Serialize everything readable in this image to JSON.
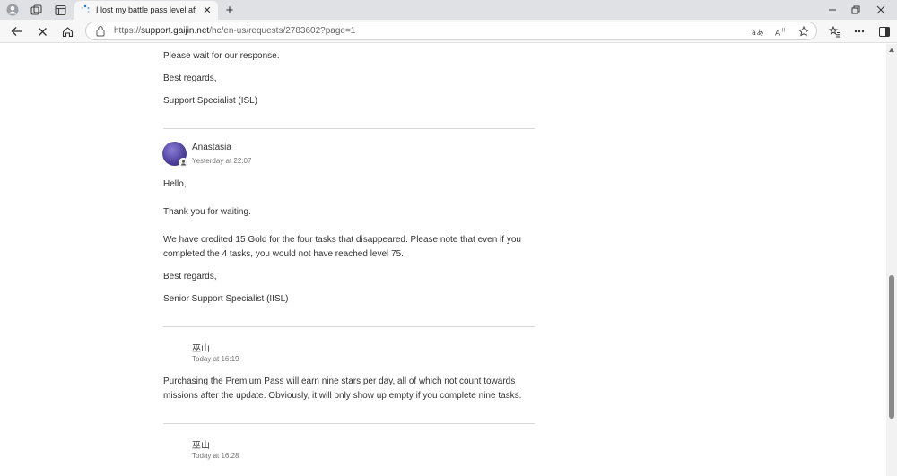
{
  "browser": {
    "tab": {
      "title": "I lost my battle pass level after last update"
    },
    "address": {
      "url_scheme": "https://",
      "url_host": "support.gaijin.net",
      "url_path": "/hc/en-us/requests/2783602?page=1"
    },
    "icons": {
      "profile": "profile-icon",
      "workspaces": "workspaces-icon",
      "tab_actions": "tab-actions-icon",
      "back": "back-arrow-icon",
      "stop": "stop-icon",
      "home": "home-icon",
      "lock": "lock-icon",
      "translate": "translate-icon",
      "read_aloud": "read-aloud-icon",
      "favorite": "star-icon",
      "favorites": "favorites-icon",
      "more": "more-icon",
      "sidebar": "sidebar-icon"
    },
    "colors": {
      "chrome": "#dfe1e5",
      "toolbar": "#f7f7f7",
      "accent": "#1a73e8"
    }
  },
  "thread": {
    "previous_message": {
      "lines": [
        "Please wait for our response.",
        "Best regards,",
        "Support Specialist (ISL)"
      ]
    },
    "comments": [
      {
        "author": "Anastasia",
        "time": "Yesterday at 22:07",
        "paragraphs": [
          "Hello,",
          "Thank you for waiting.",
          "We have credited 15 Gold for the four tasks that disappeared. Please note that even if you",
          "completed the 4 tasks, you would not have reached level 75.",
          "Best regards,",
          "Senior Support Specialist (IISL)"
        ]
      },
      {
        "author": "巫山",
        "time": "Today at 16:19",
        "paragraphs": [
          "Purchasing the Premium Pass will earn nine stars per day, all of which not count towards",
          "missions after the update. Obviously, it will only show up empty if you complete nine tasks."
        ]
      },
      {
        "author": "巫山",
        "time": "Today at 16:28"
      }
    ]
  }
}
